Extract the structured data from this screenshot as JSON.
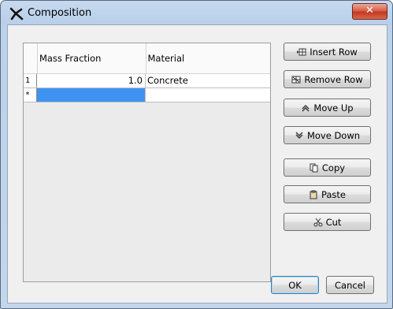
{
  "window": {
    "title": "Composition",
    "close_glyph": "✕",
    "accent_color": "#3e93f2"
  },
  "table": {
    "columns": [
      "Mass Fraction",
      "Material"
    ],
    "rows": [
      {
        "row_label": "1",
        "mass_fraction": "1.0",
        "material": "Concrete"
      },
      {
        "row_label": "*",
        "mass_fraction": "",
        "material": ""
      }
    ]
  },
  "buttons": {
    "insert_row": "Insert Row",
    "remove_row": "Remove Row",
    "move_up": "Move Up",
    "move_down": "Move Down",
    "copy": "Copy",
    "paste": "Paste",
    "cut": "Cut",
    "ok": "OK",
    "cancel": "Cancel"
  },
  "icons": {
    "title": "tool-icon",
    "insert_row": "insert-row-icon",
    "remove_row": "remove-row-icon",
    "move_up": "chevron-up-icon",
    "move_down": "chevron-down-icon",
    "copy": "copy-icon",
    "paste": "paste-icon",
    "cut": "scissors-icon"
  }
}
